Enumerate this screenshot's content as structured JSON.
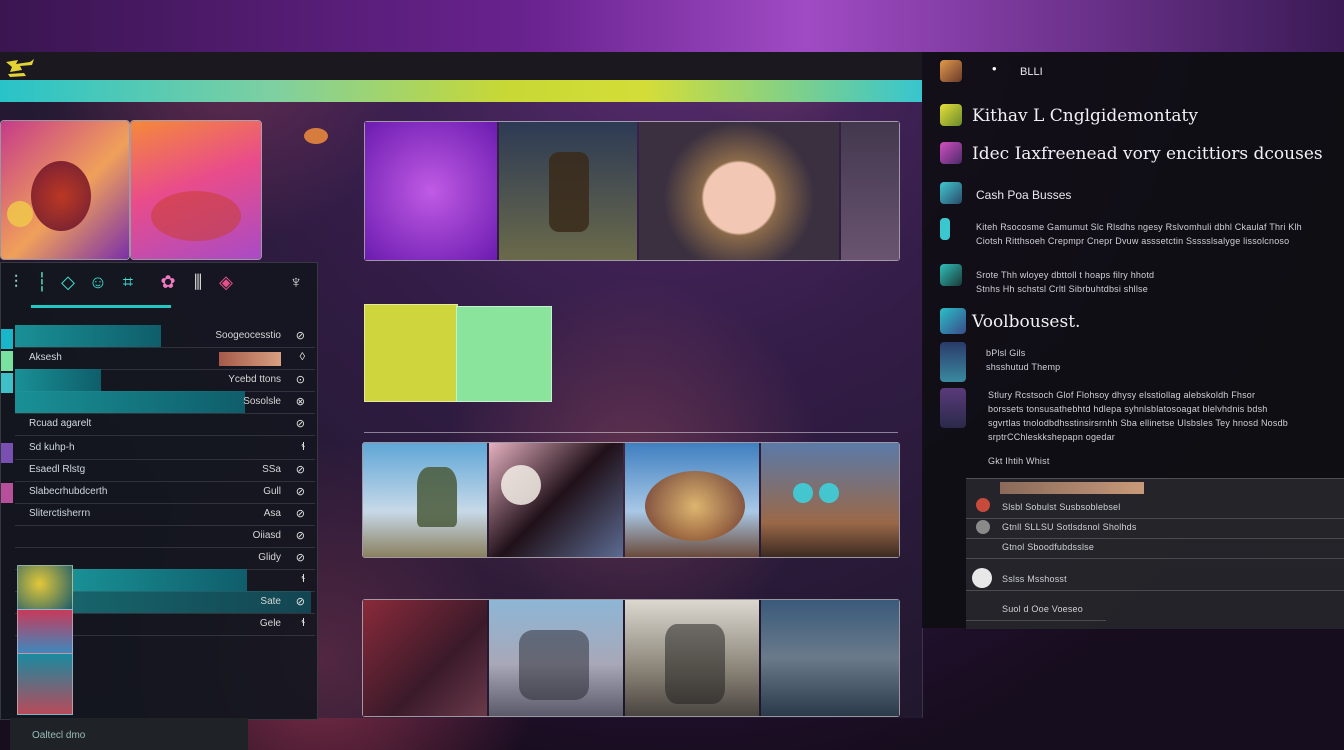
{
  "left_panel": {
    "rows": [
      {
        "label": "",
        "right": "Soogeocesstio",
        "icon": "⊘"
      },
      {
        "label": "Aksesh",
        "right": "",
        "icon": "◊"
      },
      {
        "label": "",
        "right": "Ycebd ttons",
        "icon": "⊙"
      },
      {
        "label": "",
        "right": "Sosolsle",
        "icon": "⊗"
      },
      {
        "label": "Rcuad agarelt",
        "right": "",
        "icon": "⊘"
      },
      {
        "label": "Sd kuhp-h",
        "right": "",
        "icon": "ɬ"
      },
      {
        "label": "Esaedl Rlstg",
        "right": "SSa",
        "icon": "⊘"
      },
      {
        "label": "Slabecrhubdcerth",
        "right": "Gull",
        "icon": "⊘"
      },
      {
        "label": "Sliterctisherrn",
        "right": "Asa",
        "icon": "⊘"
      },
      {
        "label": "",
        "right": "Oiiasd",
        "icon": "⊘"
      },
      {
        "label": "",
        "right": "Glidy",
        "icon": "⊘"
      },
      {
        "label": "",
        "right": "",
        "icon": "ɬ"
      },
      {
        "label": "",
        "right": "Sate",
        "icon": "⊘"
      },
      {
        "label": "",
        "right": "Gele",
        "icon": "ɬ"
      }
    ],
    "footer_label": "Oaltecl dmo"
  },
  "right_panel": {
    "header_label": "BLLI",
    "heading_1": "Kithav L Cnglgidemontaty",
    "heading_2": "Idec Iaxfreenead vory encittiors dcouses",
    "subheading": "Cash Poa Busses",
    "para_1": [
      "Kiteh Rsocosme Gamumut Slc Rlsdhs ngesy Rslvomhuli dbhl Ckaulaf Thri Klh",
      "Ciotsh Ritthsoeh Crepmpr Cnepr Dvuw asssetctin Ssssslsalyge lissolcnoso"
    ],
    "para_2": [
      "Srote Thh wloyey dbttoll t hoaps filry hhotd",
      "Stnhs Hh schstsl Crltl Sibrbuhtdbsi shllse"
    ],
    "title_3": "Voolbousest.",
    "list_a": [
      "bPlsl Gils",
      "shsshutud Themp"
    ],
    "para_3": [
      "Stlury Rcstsoch Glof Flohsoy dhysy elsstiollag alebskoldh Fhsor",
      "borssets tonsusathebhtd hdlepa syhnlsblatosoagat blelvhdnis bdsh",
      "sgvrtlas tnolodbdhsstinsirsrnhh Sba ellinetse Ulsbsles Tey hnosd Nosdb",
      "srptrCChleskkshepapn ogedar"
    ],
    "short_row": "Gkt Ihtih Whist",
    "list_rows": [
      "Slsbl Sobulst Susbsoblebsel",
      "Gtnll SLLSU Sotlsdsnol Sholhds",
      "Gtnol Sboodfubdsslse",
      "Sslss Msshosst",
      "Suol d Ooe Voeseo"
    ]
  }
}
